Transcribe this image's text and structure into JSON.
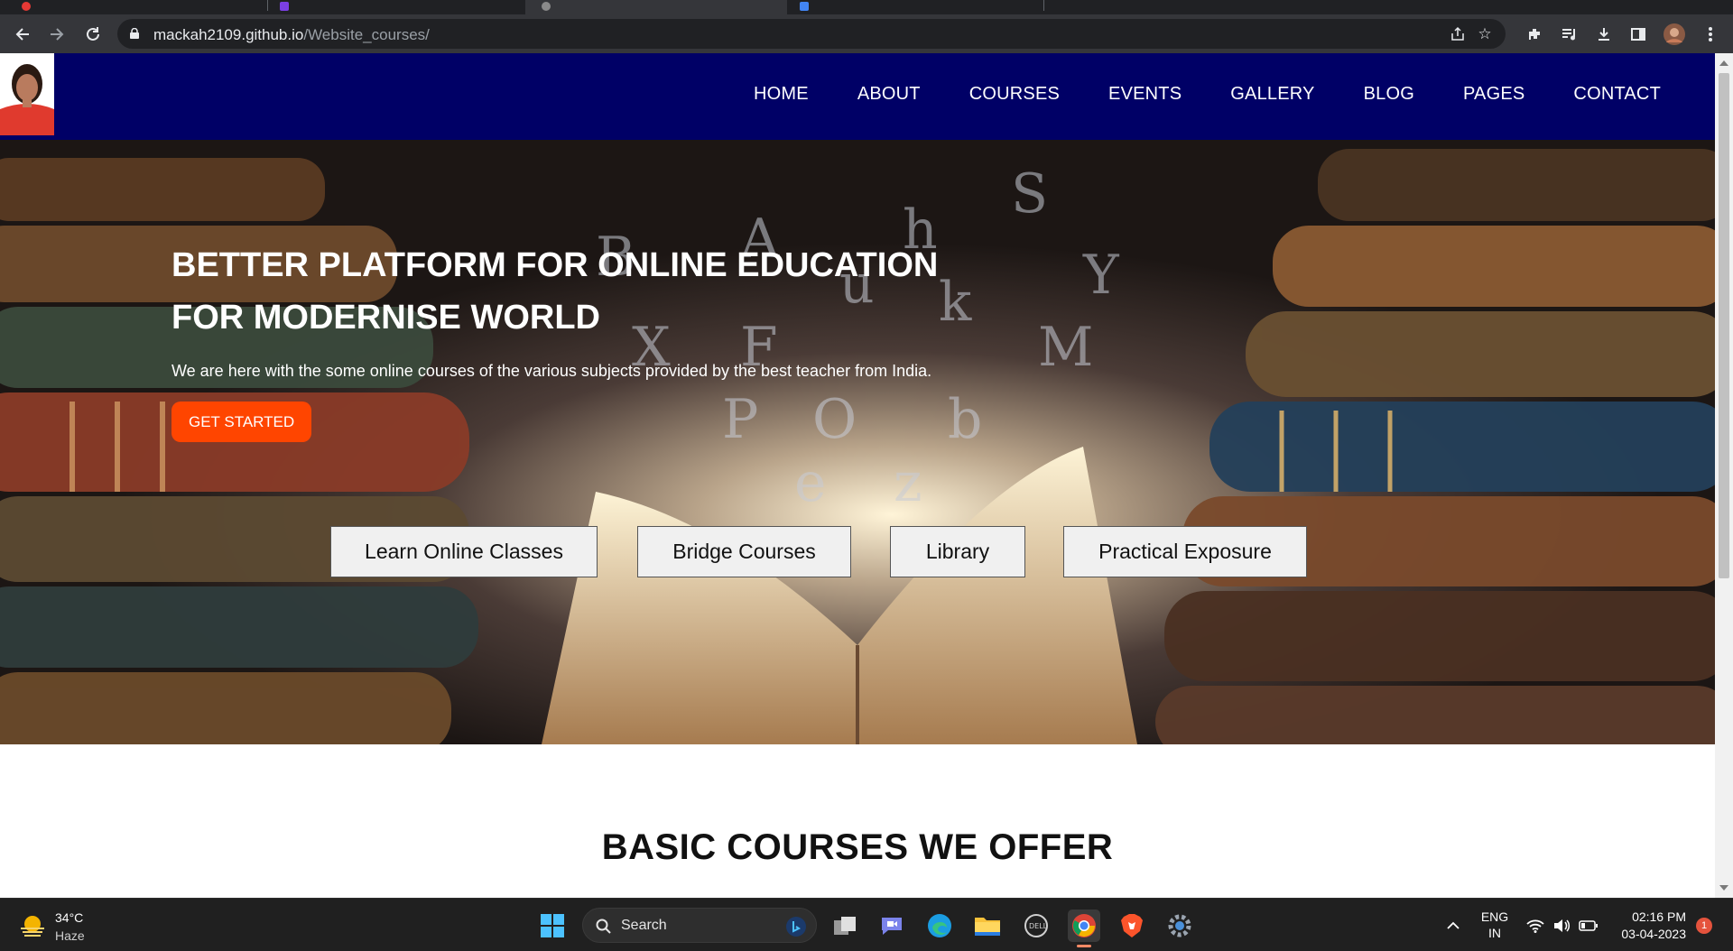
{
  "browser": {
    "url_host": "mackah2109.github.io",
    "url_path": "/Website_courses/",
    "icons": [
      "back-icon",
      "forward-icon",
      "reload-icon",
      "lock-icon",
      "share-icon",
      "bookmark-star-icon",
      "extensions-icon",
      "media-icon",
      "downloads-icon",
      "side-panel-icon",
      "profile-avatar",
      "menu-icon"
    ]
  },
  "site": {
    "nav": {
      "items": [
        {
          "label": "HOME"
        },
        {
          "label": "ABOUT"
        },
        {
          "label": "COURSES"
        },
        {
          "label": "EVENTS"
        },
        {
          "label": "GALLERY"
        },
        {
          "label": "BLOG"
        },
        {
          "label": "PAGES"
        },
        {
          "label": "CONTACT"
        }
      ],
      "background": "#000066"
    },
    "hero": {
      "title_line1": "BETTER PLATFORM FOR ONLINE EDUCATION",
      "title_line2": "FOR MODERNISE WORLD",
      "text": "We are here with the some online courses of the various subjects provided by the best teacher from India.",
      "cta_label": "GET STARTED",
      "cta_color": "#ff4500",
      "features": [
        {
          "label": "Learn Online Classes"
        },
        {
          "label": "Bridge Courses"
        },
        {
          "label": "Library"
        },
        {
          "label": "Practical Exposure"
        }
      ]
    },
    "section_title": "BASIC COURSES WE OFFER"
  },
  "taskbar": {
    "weather_temp": "34°C",
    "weather_desc": "Haze",
    "search_label": "Search",
    "lang_line1": "ENG",
    "lang_line2": "IN",
    "time": "02:16 PM",
    "date": "03-04-2023",
    "notification_count": "1"
  }
}
